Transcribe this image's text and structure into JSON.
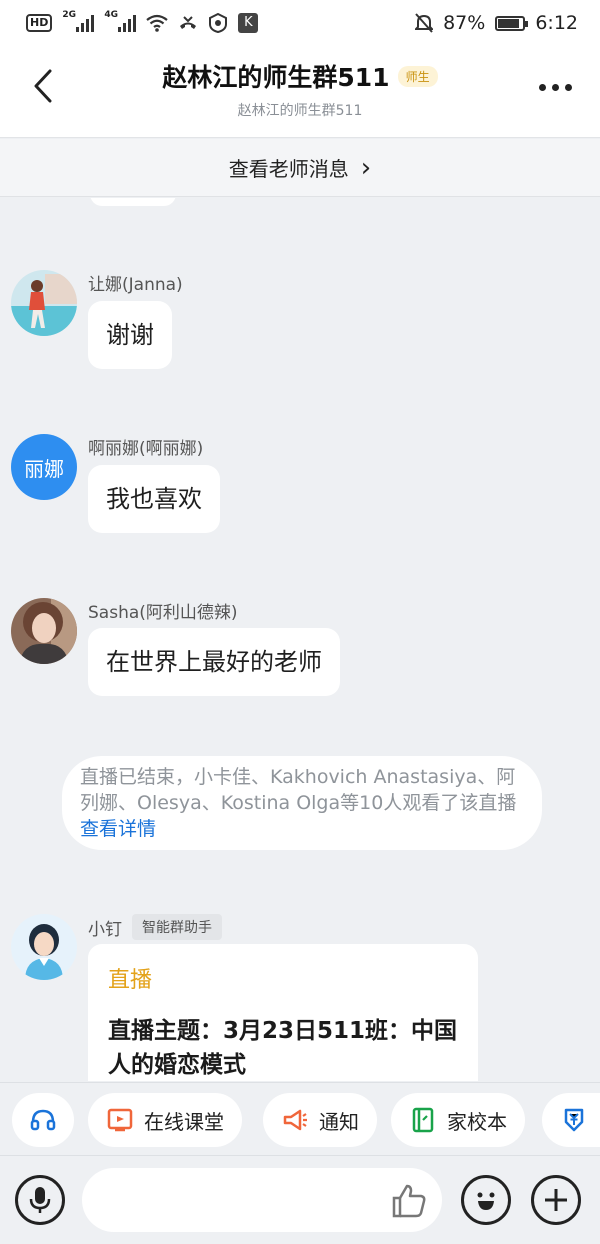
{
  "status_bar": {
    "hd_label": "HD",
    "signal_1_tag": "2G",
    "signal_2_tag": "4G",
    "k_label": "K",
    "battery_percent": "87%",
    "time": "6:12"
  },
  "header": {
    "title": "赵林江的师生群511",
    "badge": "师生",
    "subtitle": "赵林江的师生群511"
  },
  "teacher_bar": {
    "label": "查看老师消息",
    "chevron": "›"
  },
  "messages": [
    {
      "sender": "让娜(Janna)",
      "text": "谢谢"
    },
    {
      "sender": "啊丽娜(啊丽娜)",
      "avatar_text": "丽娜",
      "text": "我也喜欢"
    },
    {
      "sender": "Sasha(阿利山德辣)",
      "text": "在世界上最好的老师"
    }
  ],
  "system_notice": {
    "text": "直播已结束，小卡佳、Kakhovich Anastasiya、阿列娜、Olesya、Kostina Olga等10人观看了该直播",
    "link": "查看详情"
  },
  "bot_message": {
    "sender": "小钉",
    "tag": "智能群助手",
    "card_type": "直播",
    "card_title": "直播主题：3月23日511班：中国人的婚恋模式"
  },
  "quick_actions": [
    {
      "label": "在线课堂",
      "icon": "online-class-icon",
      "color": "#f0663a"
    },
    {
      "label": "通知",
      "icon": "megaphone-icon",
      "color": "#f0663a"
    },
    {
      "label": "家校本",
      "icon": "notebook-icon",
      "color": "#19a34a"
    }
  ],
  "colors": {
    "accent_blue": "#1a73d9",
    "live_orange": "#e3a21a",
    "avatar_blue": "#2e8ef0"
  }
}
